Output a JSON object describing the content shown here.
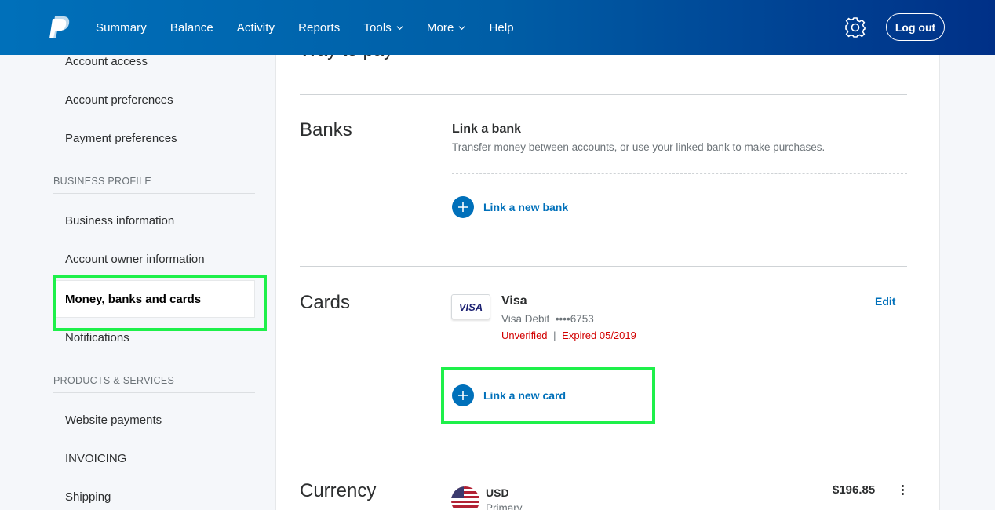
{
  "header": {
    "nav": [
      {
        "label": "Summary"
      },
      {
        "label": "Balance"
      },
      {
        "label": "Activity"
      },
      {
        "label": "Reports"
      },
      {
        "label": "Tools",
        "dropdown": true
      },
      {
        "label": "More",
        "dropdown": true
      },
      {
        "label": "Help"
      }
    ],
    "logout_label": "Log out",
    "icons": {
      "logo": "paypal-logo",
      "settings": "gear-icon"
    }
  },
  "sidebar": {
    "top_items": [
      {
        "label": "Account access"
      },
      {
        "label": "Account preferences"
      },
      {
        "label": "Payment preferences"
      }
    ],
    "business_section": "BUSINESS PROFILE",
    "business_items": [
      {
        "label": "Business information"
      },
      {
        "label": "Account owner information"
      },
      {
        "label": "Money, banks and cards",
        "active": true
      },
      {
        "label": "Notifications"
      }
    ],
    "products_section": "PRODUCTS & SERVICES",
    "products_items": [
      {
        "label": "Website payments"
      },
      {
        "label": "INVOICING"
      },
      {
        "label": "Shipping"
      }
    ]
  },
  "main": {
    "cut_title": "Way to pay",
    "banks": {
      "title": "Banks",
      "link_title": "Link a bank",
      "description": "Transfer money between accounts, or use your linked bank to make purchases.",
      "link_new_label": "Link a new bank"
    },
    "cards": {
      "title": "Cards",
      "card_brand_badge": "VISA",
      "card_name": "Visa",
      "card_type": "Visa Debit",
      "card_number": "••••6753",
      "status_unverified": "Unverified",
      "status_separator": "|",
      "status_expired": "Expired 05/2019",
      "edit_label": "Edit",
      "link_new_label": "Link a new card"
    },
    "currency": {
      "title": "Currency",
      "code": "USD",
      "subtitle": "Primary",
      "amount": "$196.85"
    }
  },
  "colors": {
    "header_start": "#0070ba",
    "header_end": "#003087",
    "link_blue": "#0070ba",
    "error_red": "#d20000",
    "highlight_green": "#1ef04a"
  }
}
